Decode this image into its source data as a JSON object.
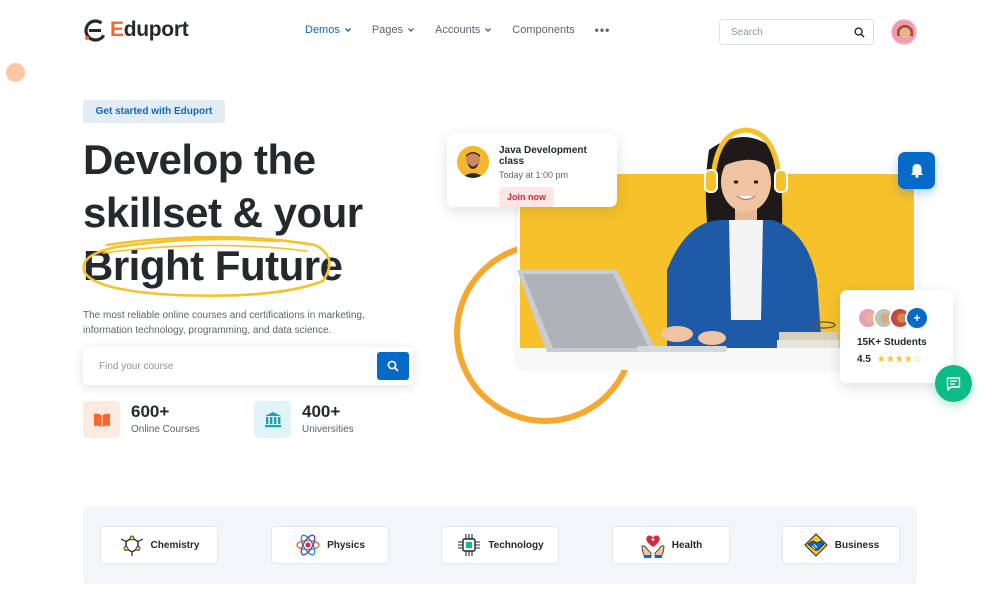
{
  "header": {
    "logo": {
      "first_letter": "E",
      "rest": "duport"
    },
    "nav": [
      {
        "label": "Demos",
        "active": true,
        "has_dropdown": true
      },
      {
        "label": "Pages",
        "active": false,
        "has_dropdown": true
      },
      {
        "label": "Accounts",
        "active": false,
        "has_dropdown": true
      },
      {
        "label": "Components",
        "active": false,
        "has_dropdown": false
      }
    ],
    "more_icon": "more-dots-icon",
    "search": {
      "placeholder": "Search"
    }
  },
  "hero": {
    "badge": "Get started with Eduport",
    "title_lines": [
      "Develop the",
      "skillset & your",
      "Bright Future"
    ],
    "description": "The most reliable online courses and certifications in marketing, information technology, programming, and data science.",
    "course_search": {
      "placeholder": "Find your course"
    },
    "stats": [
      {
        "value": "600+",
        "label": "Online Courses",
        "icon": "book-icon",
        "color": "#f7682c"
      },
      {
        "value": "400+",
        "label": "Universities",
        "icon": "university-icon",
        "color": "#17a2b8"
      }
    ]
  },
  "class_card": {
    "title": "Java Development class",
    "time": "Today at 1:00 pm",
    "button": "Join now"
  },
  "students_card": {
    "plus": "+",
    "count_label": "15K+ Students",
    "rating": "4.5",
    "stars": "★★★★☆"
  },
  "categories": [
    {
      "label": "Chemistry",
      "icon": "chemistry-molecule-icon"
    },
    {
      "label": "Physics",
      "icon": "physics-atom-icon"
    },
    {
      "label": "Technology",
      "icon": "technology-chip-icon"
    },
    {
      "label": "Health",
      "icon": "health-heart-hands-icon"
    },
    {
      "label": "Business",
      "icon": "business-handshake-icon"
    }
  ],
  "colors": {
    "primary": "#066ac9",
    "orange": "#f7682c",
    "yellow": "#f6c12b",
    "success": "#0cbc87",
    "dark": "#24292d"
  }
}
